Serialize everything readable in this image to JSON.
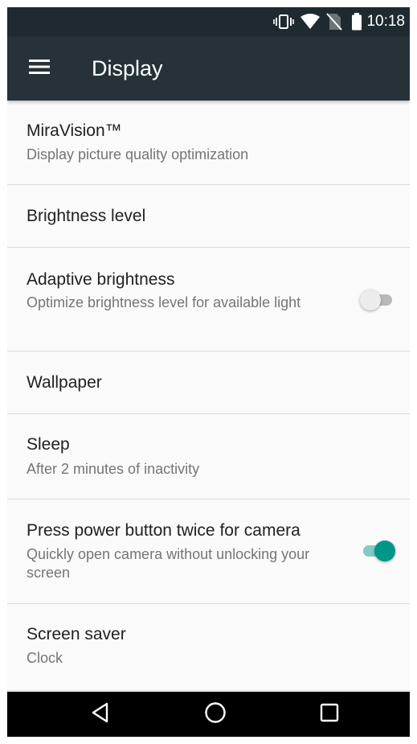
{
  "status_bar": {
    "time": "10:18",
    "icons": [
      "vibrate-icon",
      "wifi-icon",
      "no-sim-icon",
      "battery-icon"
    ]
  },
  "toolbar": {
    "title": "Display",
    "menu_icon": "hamburger-menu-icon",
    "background": "#263238"
  },
  "settings": [
    {
      "title": "MiraVision™",
      "summary": "Display picture quality optimization"
    },
    {
      "title": "Brightness level"
    },
    {
      "title": "Adaptive brightness",
      "summary": "Optimize brightness level for available light",
      "switch": false
    },
    {
      "title": "Wallpaper"
    },
    {
      "title": "Sleep",
      "summary": "After 2 minutes of inactivity"
    },
    {
      "title": "Press power button twice for camera",
      "summary": "Quickly open camera without unlocking your screen",
      "switch": true
    },
    {
      "title": "Screen saver",
      "summary": "Clock"
    }
  ],
  "nav_bar": {
    "buttons": [
      "back-icon",
      "home-icon",
      "recents-icon"
    ]
  },
  "colors": {
    "accent": "#009688",
    "accent_light": "#80cbc4"
  }
}
